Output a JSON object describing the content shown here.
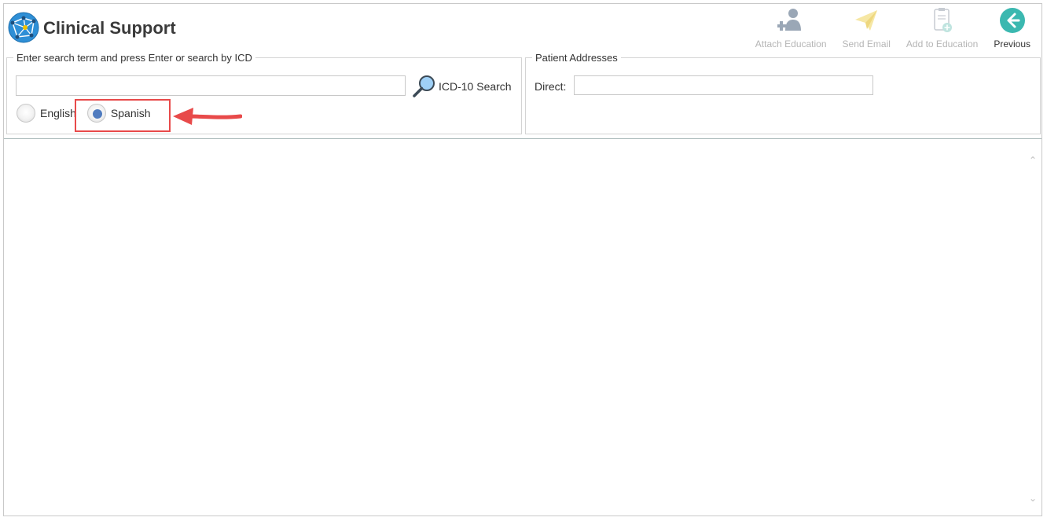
{
  "app": {
    "title": "Clinical Support"
  },
  "toolbar": {
    "attach_education": "Attach Education",
    "send_email": "Send Email",
    "add_to_education": "Add to Education",
    "previous": "Previous"
  },
  "search": {
    "legend": "Enter search term and press Enter or search by ICD",
    "input_value": "",
    "icd_button": "ICD-10 Search",
    "languages": [
      {
        "label": "English",
        "checked": false
      },
      {
        "label": "Spanish",
        "checked": true
      }
    ]
  },
  "addresses": {
    "legend": "Patient Addresses",
    "direct_label": "Direct:",
    "direct_value": ""
  },
  "colors": {
    "accent": "#4f7bbf",
    "highlight": "#e84a4a",
    "previous_icon": "#3bb8b0"
  }
}
